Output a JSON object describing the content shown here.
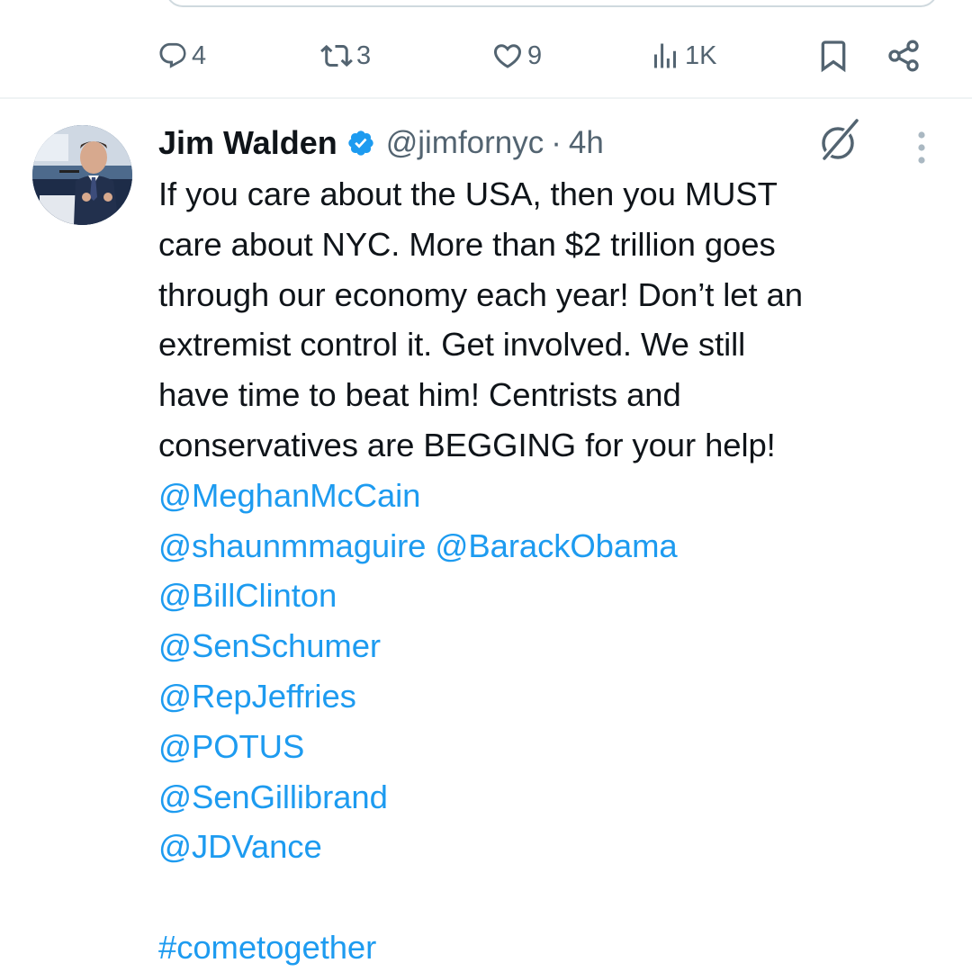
{
  "actions": {
    "reply_count": "4",
    "retweet_count": "3",
    "like_count": "9",
    "view_count": "1K"
  },
  "tweet": {
    "display_name": "Jim Walden",
    "handle": "@jimfornyc",
    "separator": "·",
    "time": "4h",
    "text_lines": [
      "If you care about the USA, then you MUST",
      "care about NYC. More than $2 trillion goes",
      "through our economy each year!  Don’t let an",
      "extremist control it. Get involved. We still",
      "have time to beat him!  Centrists and",
      "conservatives are BEGGING for your help!"
    ],
    "mentions": {
      "meghan": "@MeghanMcCain",
      "shaun": "@shaunmmaguire",
      "obama": "@BarackObama",
      "clinton": "@BillClinton",
      "schumer": "@SenSchumer",
      "jeffries": "@RepJeffries",
      "potus": "@POTUS",
      "gillibrand": "@SenGillibrand",
      "vance": "@JDVance"
    },
    "hashtag": "#cometogether"
  },
  "icons": {
    "reply": "reply-bubble-icon",
    "retweet": "retweet-icon",
    "like": "heart-icon",
    "views": "views-chart-icon",
    "bookmark": "bookmark-icon",
    "share": "share-icon",
    "verified": "verified-badge-icon",
    "grok": "grok-icon",
    "more": "more-vertical-icon"
  },
  "colors": {
    "link": "#1d9bf0",
    "muted": "#536471",
    "text": "#0f1419",
    "verified": "#1d9bf0"
  }
}
